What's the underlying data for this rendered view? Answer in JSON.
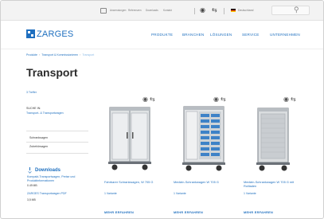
{
  "topbar": {
    "links": [
      "Anwendungen",
      "Referenzen",
      "Downloads",
      "Kontakt"
    ],
    "language": "Deutschland"
  },
  "header": {
    "logo_text": "ZARGES",
    "nav": [
      "PRODUKTE",
      "BRANCHEN",
      "LÖSUNGEN",
      "SERVICE",
      "UNTERNEHMEN"
    ]
  },
  "breadcrumb": {
    "items": [
      "Produkte",
      "Transport & Kommissionieren"
    ],
    "current": "Transport"
  },
  "page": {
    "title": "Transport",
    "result_count": "3 Treffer"
  },
  "sidebar": {
    "search_in_label": "SUCHE IN:",
    "category_link": "Transport- & Transportwagen",
    "filters": [
      "Schranksagen",
      "Zubehörsagen"
    ]
  },
  "downloads": {
    "heading": "Downloads",
    "items": [
      {
        "title": "Kompakt-Transportwagen, Preise und Produktinformationen",
        "meta": "0.49 MB"
      },
      {
        "title": "ZARGES Transportwagen PDF",
        "meta": "3,5 MB"
      }
    ]
  },
  "products": [
    {
      "title": "Fahrbarer Schrankwagen, W 705 G",
      "variants": "1 Variante",
      "more": "MEHR ERFAHREN"
    },
    {
      "title": "Medizin-Schrankwagen W 705 G",
      "variants": "1 Variante",
      "more": "MEHR ERFAHREN"
    },
    {
      "title": "Medizin-Schrankwagen W 705 G mit Rollladen",
      "variants": "1 Variante",
      "more": "MEHR ERFAHREN"
    }
  ],
  "icons": {
    "compare": "compare-icon",
    "wishlist": "wishlist-icon",
    "search": "search-icon",
    "grid": "grid-icon"
  },
  "colors": {
    "brand": "#1e6fbf",
    "text": "#333333",
    "topbar_bg": "#f3f3f3"
  }
}
